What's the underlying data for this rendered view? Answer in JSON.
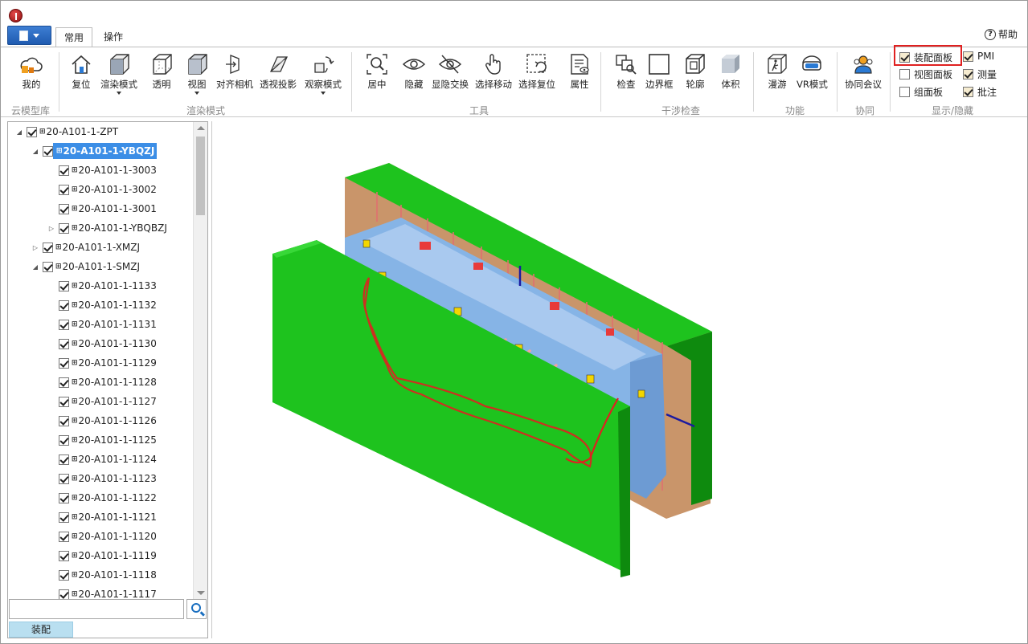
{
  "ribbon_tabs": [
    "常用",
    "操作"
  ],
  "help_label": "帮助",
  "tools": {
    "my": "我的",
    "reset": "复位",
    "render_mode": "渲染模式",
    "transparent": "透明",
    "view": "视图",
    "align_camera": "对齐相机",
    "perspective": "透视投影",
    "observe_mode": "观察模式",
    "center": "居中",
    "hide": "隐藏",
    "swap_hide": "显隐交换",
    "select_move": "选择移动",
    "select_reset": "选择复位",
    "properties": "属性",
    "check": "检查",
    "bounding_box": "边界框",
    "outline": "轮廓",
    "volume": "体积",
    "roam": "漫游",
    "vr_mode": "VR模式",
    "meeting": "协同会议"
  },
  "groups": {
    "cloud_library": "云模型库",
    "render_mode": "渲染模式",
    "tools": "工具",
    "interference": "干涉检查",
    "function": "功能",
    "collaboration": "协同",
    "display": "显示/隐藏"
  },
  "display_toggles": [
    {
      "label": "装配面板",
      "checked": true
    },
    {
      "label": "视图面板",
      "checked": false
    },
    {
      "label": "组面板",
      "checked": false
    },
    {
      "label": "PMI",
      "checked": true
    },
    {
      "label": "测量",
      "checked": true
    },
    {
      "label": "批注",
      "checked": true
    }
  ],
  "tree": {
    "root": "20-A101-1-ZPT",
    "nodes": [
      {
        "label": "20-A101-1-YBQZJ",
        "level": 1,
        "expander": "open",
        "selected": true
      },
      {
        "label": "20-A101-1-3003",
        "level": 2,
        "expander": "none"
      },
      {
        "label": "20-A101-1-3002",
        "level": 2,
        "expander": "none"
      },
      {
        "label": "20-A101-1-3001",
        "level": 2,
        "expander": "none"
      },
      {
        "label": "20-A101-1-YBQBZJ",
        "level": 2,
        "expander": "closed"
      },
      {
        "label": "20-A101-1-XMZJ",
        "level": 1,
        "expander": "closed"
      },
      {
        "label": "20-A101-1-SMZJ",
        "level": 1,
        "expander": "open"
      },
      {
        "label": "20-A101-1-1133",
        "level": 2,
        "expander": "none"
      },
      {
        "label": "20-A101-1-1132",
        "level": 2,
        "expander": "none"
      },
      {
        "label": "20-A101-1-1131",
        "level": 2,
        "expander": "none"
      },
      {
        "label": "20-A101-1-1130",
        "level": 2,
        "expander": "none"
      },
      {
        "label": "20-A101-1-1129",
        "level": 2,
        "expander": "none"
      },
      {
        "label": "20-A101-1-1128",
        "level": 2,
        "expander": "none"
      },
      {
        "label": "20-A101-1-1127",
        "level": 2,
        "expander": "none"
      },
      {
        "label": "20-A101-1-1126",
        "level": 2,
        "expander": "none"
      },
      {
        "label": "20-A101-1-1125",
        "level": 2,
        "expander": "none"
      },
      {
        "label": "20-A101-1-1124",
        "level": 2,
        "expander": "none"
      },
      {
        "label": "20-A101-1-1123",
        "level": 2,
        "expander": "none"
      },
      {
        "label": "20-A101-1-1122",
        "level": 2,
        "expander": "none"
      },
      {
        "label": "20-A101-1-1121",
        "level": 2,
        "expander": "none"
      },
      {
        "label": "20-A101-1-1120",
        "level": 2,
        "expander": "none"
      },
      {
        "label": "20-A101-1-1119",
        "level": 2,
        "expander": "none"
      },
      {
        "label": "20-A101-1-1118",
        "level": 2,
        "expander": "none"
      },
      {
        "label": "20-A101-1-1117",
        "level": 2,
        "expander": "none"
      }
    ]
  },
  "search": {
    "placeholder": ""
  },
  "panel_tab": "装配",
  "colors": {
    "accent": "#3c8ee6",
    "highlight_border": "#e02020",
    "model_green": "#1ec31e",
    "model_blue": "#86b4e6"
  }
}
